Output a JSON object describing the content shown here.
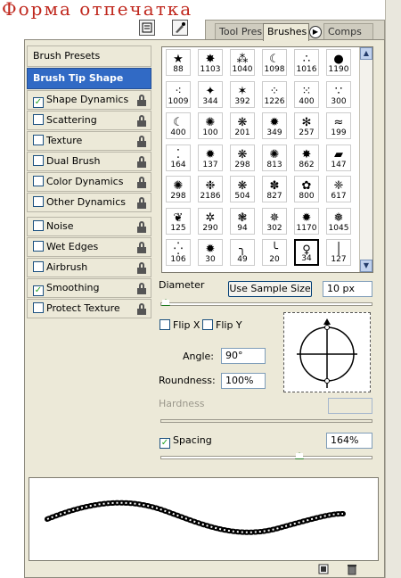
{
  "page_title": "Форма отпечатка",
  "tabs": [
    {
      "label": "Tool Pres",
      "active": false
    },
    {
      "label": "Brushes",
      "active": true
    },
    {
      "label": "Comps",
      "active": false
    }
  ],
  "sidebar": {
    "header": "Brush Presets",
    "items": [
      {
        "label": "Brush Tip Shape",
        "selected": true,
        "checkbox": false,
        "lock": false
      },
      {
        "label": "Shape Dynamics",
        "checked": true,
        "checkbox": true,
        "lock": true
      },
      {
        "label": "Scattering",
        "checked": false,
        "checkbox": true,
        "lock": true
      },
      {
        "label": "Texture",
        "checked": false,
        "checkbox": true,
        "lock": true
      },
      {
        "label": "Dual Brush",
        "checked": false,
        "checkbox": true,
        "lock": true
      },
      {
        "label": "Color Dynamics",
        "checked": false,
        "checkbox": true,
        "lock": true
      },
      {
        "label": "Other Dynamics",
        "checked": false,
        "checkbox": true,
        "lock": true
      },
      {
        "label": "Noise",
        "checked": false,
        "checkbox": true,
        "lock": true
      },
      {
        "label": "Wet Edges",
        "checked": false,
        "checkbox": true,
        "lock": true
      },
      {
        "label": "Airbrush",
        "checked": false,
        "checkbox": true,
        "lock": true
      },
      {
        "label": "Smoothing",
        "checked": true,
        "checkbox": true,
        "lock": true
      },
      {
        "label": "Protect Texture",
        "checked": false,
        "checkbox": true,
        "lock": true
      }
    ]
  },
  "brushes": [
    {
      "size": "88",
      "icon": "★"
    },
    {
      "size": "1103",
      "icon": "✸"
    },
    {
      "size": "1040",
      "icon": "⁂"
    },
    {
      "size": "1098",
      "icon": "☾"
    },
    {
      "size": "1016",
      "icon": "∴"
    },
    {
      "size": "1190",
      "icon": "●"
    },
    {
      "size": "1009",
      "icon": "⁖"
    },
    {
      "size": "344",
      "icon": "✦"
    },
    {
      "size": "392",
      "icon": "✶"
    },
    {
      "size": "1226",
      "icon": "⁘"
    },
    {
      "size": "400",
      "icon": "⁙"
    },
    {
      "size": "300",
      "icon": "∵"
    },
    {
      "size": "400",
      "icon": "☾"
    },
    {
      "size": "100",
      "icon": "✺"
    },
    {
      "size": "201",
      "icon": "❋"
    },
    {
      "size": "349",
      "icon": "✹"
    },
    {
      "size": "257",
      "icon": "✻"
    },
    {
      "size": "199",
      "icon": "≈"
    },
    {
      "size": "164",
      "icon": "⁚"
    },
    {
      "size": "137",
      "icon": "✹"
    },
    {
      "size": "298",
      "icon": "❋"
    },
    {
      "size": "813",
      "icon": "✺"
    },
    {
      "size": "862",
      "icon": "✸"
    },
    {
      "size": "147",
      "icon": "▰"
    },
    {
      "size": "298",
      "icon": "✺"
    },
    {
      "size": "2186",
      "icon": "❉"
    },
    {
      "size": "504",
      "icon": "❋"
    },
    {
      "size": "827",
      "icon": "✽"
    },
    {
      "size": "800",
      "icon": "✿"
    },
    {
      "size": "617",
      "icon": "❈"
    },
    {
      "size": "125",
      "icon": "❦"
    },
    {
      "size": "290",
      "icon": "✲"
    },
    {
      "size": "94",
      "icon": "❃"
    },
    {
      "size": "302",
      "icon": "✵"
    },
    {
      "size": "1170",
      "icon": "✹"
    },
    {
      "size": "1045",
      "icon": "❅"
    },
    {
      "size": "106",
      "icon": "⁛"
    },
    {
      "size": "30",
      "icon": "✹"
    },
    {
      "size": "49",
      "icon": "╮"
    },
    {
      "size": "20",
      "icon": "╰"
    },
    {
      "size": "34",
      "icon": "♀"
    },
    {
      "size": "127",
      "icon": "│"
    }
  ],
  "diameter": {
    "label": "Diameter",
    "button": "Use Sample Size",
    "value": "10 px"
  },
  "flip_x": {
    "label": "Flip X",
    "checked": false
  },
  "flip_y": {
    "label": "Flip Y",
    "checked": false
  },
  "angle": {
    "label": "Angle:",
    "value": "90°"
  },
  "roundness": {
    "label": "Roundness:",
    "value": "100%"
  },
  "hardness": {
    "label": "Hardness",
    "value": ""
  },
  "spacing": {
    "label": "Spacing",
    "checked": true,
    "value": "164%"
  },
  "colors": {
    "accent": "#316ac5",
    "title": "#c0281e",
    "panel": "#ece9d8"
  },
  "icons": [
    "tool-presets-icon",
    "brush-icon",
    "panel-menu-icon",
    "lock-icon",
    "new-brush-icon",
    "trash-icon",
    "scroll-up-icon",
    "scroll-down-icon"
  ]
}
